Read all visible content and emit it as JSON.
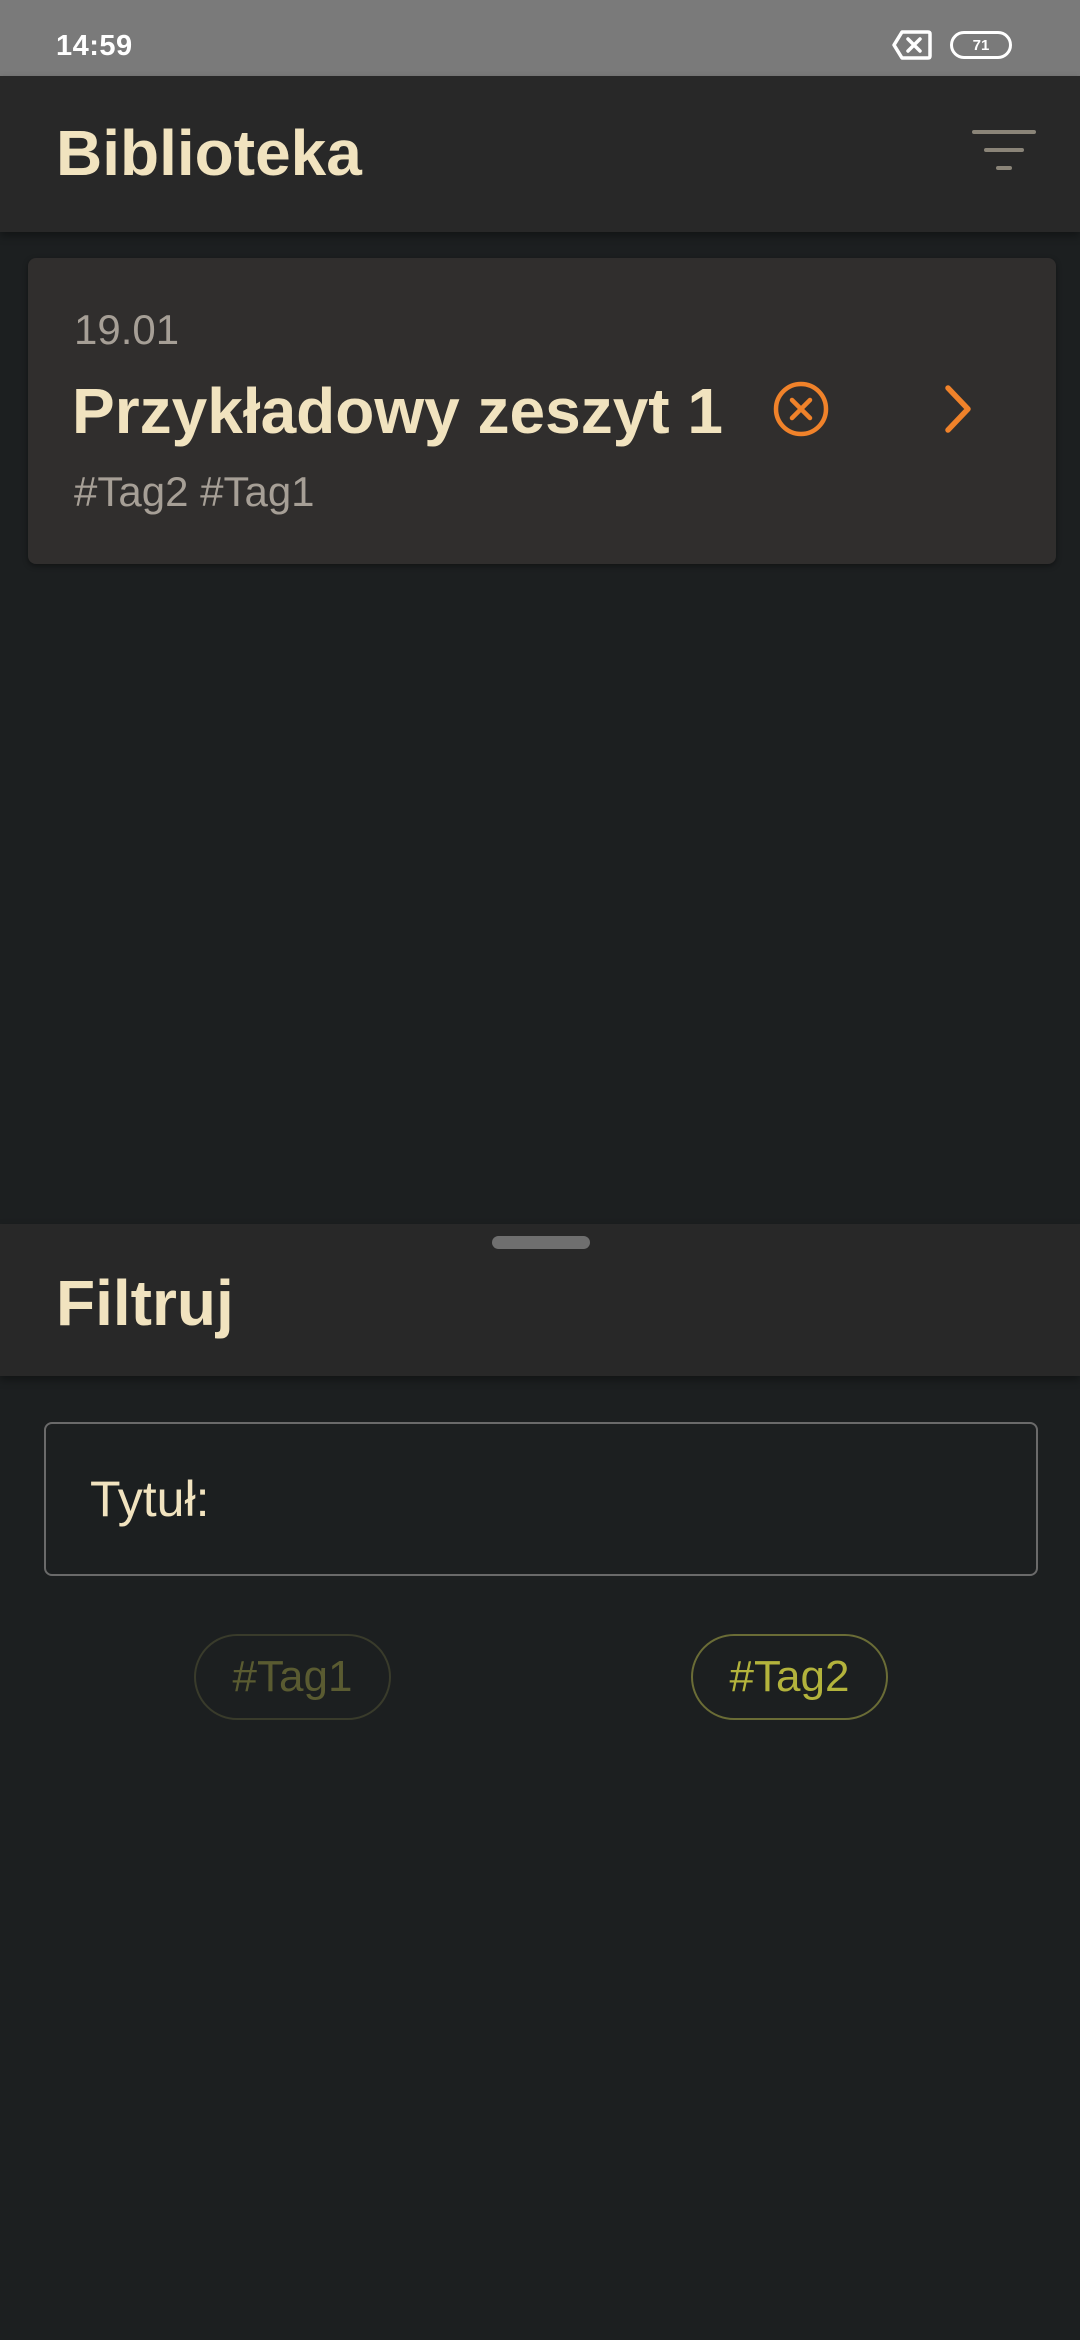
{
  "status_bar": {
    "time": "14:59",
    "battery_level": "71",
    "icons": [
      "sim-off-icon",
      "battery-icon"
    ]
  },
  "app_bar": {
    "title": "Biblioteka",
    "filter_icon": "filter-list-icon"
  },
  "notes": [
    {
      "date": "19.01",
      "title": "Przykładowy zeszyt 1",
      "tags": "#Tag2 #Tag1"
    }
  ],
  "filter_sheet": {
    "title": "Filtruj",
    "title_field_label": "Tytuł:",
    "title_field_value": "",
    "tags": [
      {
        "label": "#Tag1",
        "selected": false
      },
      {
        "label": "#Tag2",
        "selected": true
      }
    ]
  },
  "colors": {
    "background": "#1c1f20",
    "bar": "#282828",
    "card": "#302e2d",
    "primary_text": "#f1e3bf",
    "secondary_text": "#a69f96",
    "accent": "#f0822a",
    "chip_active": "#b3b33c",
    "chip_inactive": "#5a5b31"
  }
}
